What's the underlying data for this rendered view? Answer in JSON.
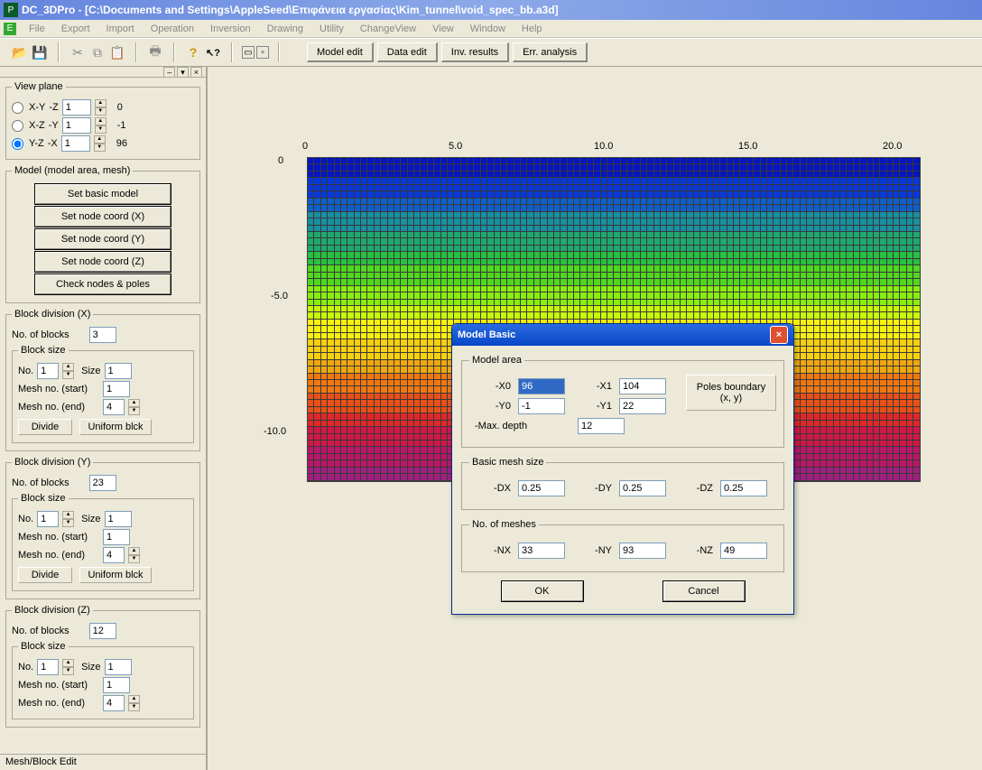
{
  "title": "DC_3DPro - [C:\\Documents and Settings\\AppleSeed\\Επιφάνεια εργασίας\\Kim_tunnel\\void_spec_bb.a3d]",
  "menu": [
    "File",
    "Export",
    "Import",
    "Operation",
    "Inversion",
    "Drawing",
    "Utility",
    "ChangeView",
    "View",
    "Window",
    "Help"
  ],
  "toolbar_modes": [
    "Model edit",
    "Data edit",
    "Inv. results",
    "Err. analysis"
  ],
  "side": {
    "viewplane": {
      "legend": "View plane",
      "xy_lbl": "X-Y",
      "xy_axis": "-Z",
      "xy_val": "1",
      "xy_out": "0",
      "xz_lbl": "X-Z",
      "xz_axis": "-Y",
      "xz_val": "1",
      "xz_out": "-1",
      "yz_lbl": "Y-Z",
      "yz_axis": "-X",
      "yz_val": "1",
      "yz_out": "96"
    },
    "model": {
      "legend": "Model (model area, mesh)",
      "b1": "Set basic model",
      "b2": "Set node coord (X)",
      "b3": "Set node coord (Y)",
      "b4": "Set node coord (Z)",
      "b5": "Check nodes & poles"
    },
    "bdx": {
      "legend": "Block division (X)",
      "nblk_lbl": "No. of blocks",
      "nblk": "3",
      "size_legend": "Block size",
      "no_lbl": "No.",
      "no": "1",
      "size_lbl": "Size",
      "size": "1",
      "ms_lbl": "Mesh no. (start)",
      "ms": "1",
      "me_lbl": "Mesh no. (end)",
      "me": "4",
      "div": "Divide",
      "uni": "Uniform blck"
    },
    "bdy": {
      "legend": "Block division (Y)",
      "nblk_lbl": "No. of blocks",
      "nblk": "23",
      "size_legend": "Block size",
      "no_lbl": "No.",
      "no": "1",
      "size_lbl": "Size",
      "size": "1",
      "ms_lbl": "Mesh no. (start)",
      "ms": "1",
      "me_lbl": "Mesh no. (end)",
      "me": "4",
      "div": "Divide",
      "uni": "Uniform blck"
    },
    "bdz": {
      "legend": "Block division (Z)",
      "nblk_lbl": "No. of blocks",
      "nblk": "12",
      "size_legend": "Block size",
      "no_lbl": "No.",
      "no": "1",
      "size_lbl": "Size",
      "size": "1",
      "ms_lbl": "Mesh no. (start)",
      "ms": "1",
      "me_lbl": "Mesh no. (end)",
      "me": "4"
    },
    "footer": "Mesh/Block Edit"
  },
  "plot": {
    "xticks": [
      "0",
      "5.0",
      "10.0",
      "15.0",
      "20.0"
    ],
    "yticks": [
      "0",
      "-5.0",
      "-10.0"
    ]
  },
  "dialog": {
    "title": "Model Basic",
    "area": {
      "legend": "Model area",
      "x0_lbl": "-X0",
      "x0": "96",
      "x1_lbl": "-X1",
      "x1": "104",
      "y0_lbl": "-Y0",
      "y0": "-1",
      "y1_lbl": "-Y1",
      "y1": "22",
      "depth_lbl": "-Max. depth",
      "depth": "12",
      "poles1": "Poles boundary",
      "poles2": "(x, y)"
    },
    "mesh": {
      "legend": "Basic mesh size",
      "dx_lbl": "-DX",
      "dx": "0.25",
      "dy_lbl": "-DY",
      "dy": "0.25",
      "dz_lbl": "-DZ",
      "dz": "0.25"
    },
    "nmesh": {
      "legend": "No. of meshes",
      "nx_lbl": "-NX",
      "nx": "33",
      "ny_lbl": "-NY",
      "ny": "93",
      "nz_lbl": "-NZ",
      "nz": "49"
    },
    "ok": "OK",
    "cancel": "Cancel"
  }
}
